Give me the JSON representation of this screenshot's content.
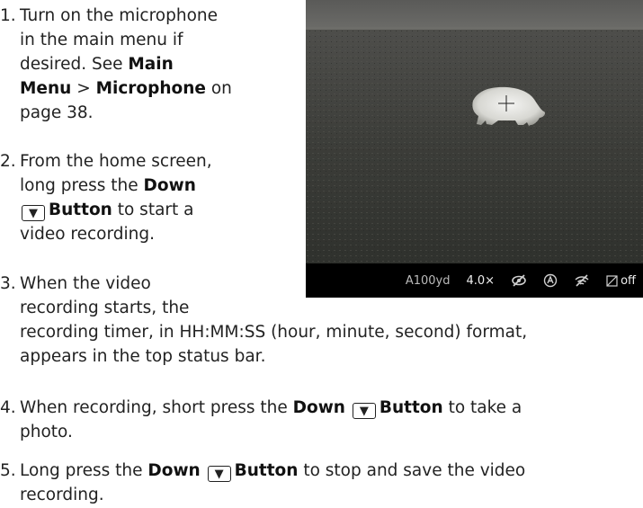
{
  "steps": [
    {
      "num": "1.",
      "parts": {
        "a": "Turn on the microphone",
        "b": "in the main menu if",
        "c": "desired. See ",
        "c_b": "Main",
        "d_b1": "Menu",
        "d": " > ",
        "d_b2": "Microphone",
        "d_end": " on",
        "e": "page 38."
      }
    },
    {
      "num": "2.",
      "parts": {
        "a": "From the home screen,",
        "b": "long press the ",
        "b_b": "Down",
        "c_btn": "▼",
        "c_b": "Button",
        "c_end": " to start a",
        "d": "video recording."
      }
    },
    {
      "num": "3.",
      "parts": {
        "a": "When the video",
        "b": "recording starts, the",
        "c": "recording timer, in HH:MM:SS (hour, minute, second) format,",
        "d": "appears in the top status bar."
      }
    },
    {
      "num": "4.",
      "parts": {
        "a": "When recording, short press the ",
        "a_b1": "Down",
        "a_btn": "▼",
        "a_b2": "Button",
        "a_end": " to take a",
        "b": "photo."
      }
    },
    {
      "num": "5.",
      "parts": {
        "a": "Long press the ",
        "a_b1": "Down",
        "a_btn": "▼",
        "a_b2": "Button",
        "a_end": " to stop and save the video",
        "b": "recording."
      }
    }
  ],
  "statusbar": {
    "rangefinder": "A100yd",
    "zoom": "4.0×",
    "record_off": "off",
    "icons": [
      "no-eye-icon",
      "auto-mode-icon",
      "wifi-off-icon",
      "ruler-off-icon"
    ]
  },
  "colors": {
    "text": "#222222",
    "statusbar_bg": "#000000"
  }
}
